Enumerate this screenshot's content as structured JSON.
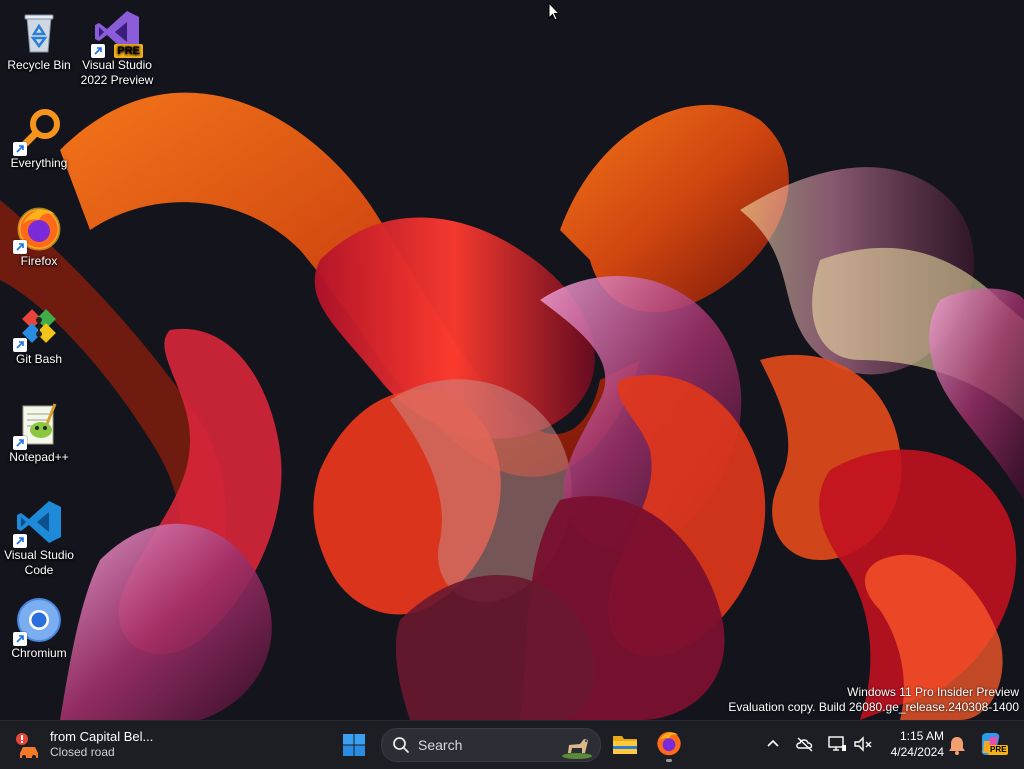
{
  "desktop": {
    "icons": [
      {
        "label": "Recycle Bin",
        "icon": "recycle-bin-icon",
        "shortcut": false
      },
      {
        "label": "Visual Studio 2022 Preview",
        "badge": "PRE",
        "icon": "visual-studio-icon",
        "shortcut": true
      },
      {
        "label": "Everything",
        "icon": "magnifier-icon",
        "shortcut": true
      },
      {
        "label": "Firefox",
        "icon": "firefox-icon",
        "shortcut": true
      },
      {
        "label": "Git Bash",
        "icon": "git-bash-icon",
        "shortcut": true
      },
      {
        "label": "Notepad++",
        "icon": "notepad-plus-plus-icon",
        "shortcut": true
      },
      {
        "label": "Visual Studio Code",
        "icon": "vscode-icon",
        "shortcut": true
      },
      {
        "label": "Chromium",
        "icon": "chromium-icon",
        "shortcut": true
      }
    ],
    "watermark": {
      "line1": "Windows 11 Pro Insider Preview",
      "line2": "Evaluation copy. Build 26080.ge_release.240308-1400"
    }
  },
  "taskbar": {
    "weather": {
      "title": "from Capital Bel...",
      "subtitle": "Closed road",
      "icon": "traffic-alert-icon"
    },
    "start_icon": "windows-start-icon",
    "search": {
      "placeholder": "Search"
    },
    "pinned": [
      {
        "name": "File Explorer",
        "icon": "folder-icon"
      },
      {
        "name": "Firefox",
        "icon": "firefox-icon",
        "running": true
      }
    ],
    "tray": {
      "icons": [
        "chevron-up-icon",
        "onedrive-offline-icon",
        "network-icon",
        "volume-muted-icon"
      ],
      "time": "1:15 AM",
      "date": "4/24/2024",
      "notification_icon": "bell-icon",
      "copilot_badge": "PRE"
    }
  },
  "colors": {
    "taskbar_bg": "#1d1e24",
    "desktop_bg": "#13141c",
    "accent": "#0078d4"
  }
}
